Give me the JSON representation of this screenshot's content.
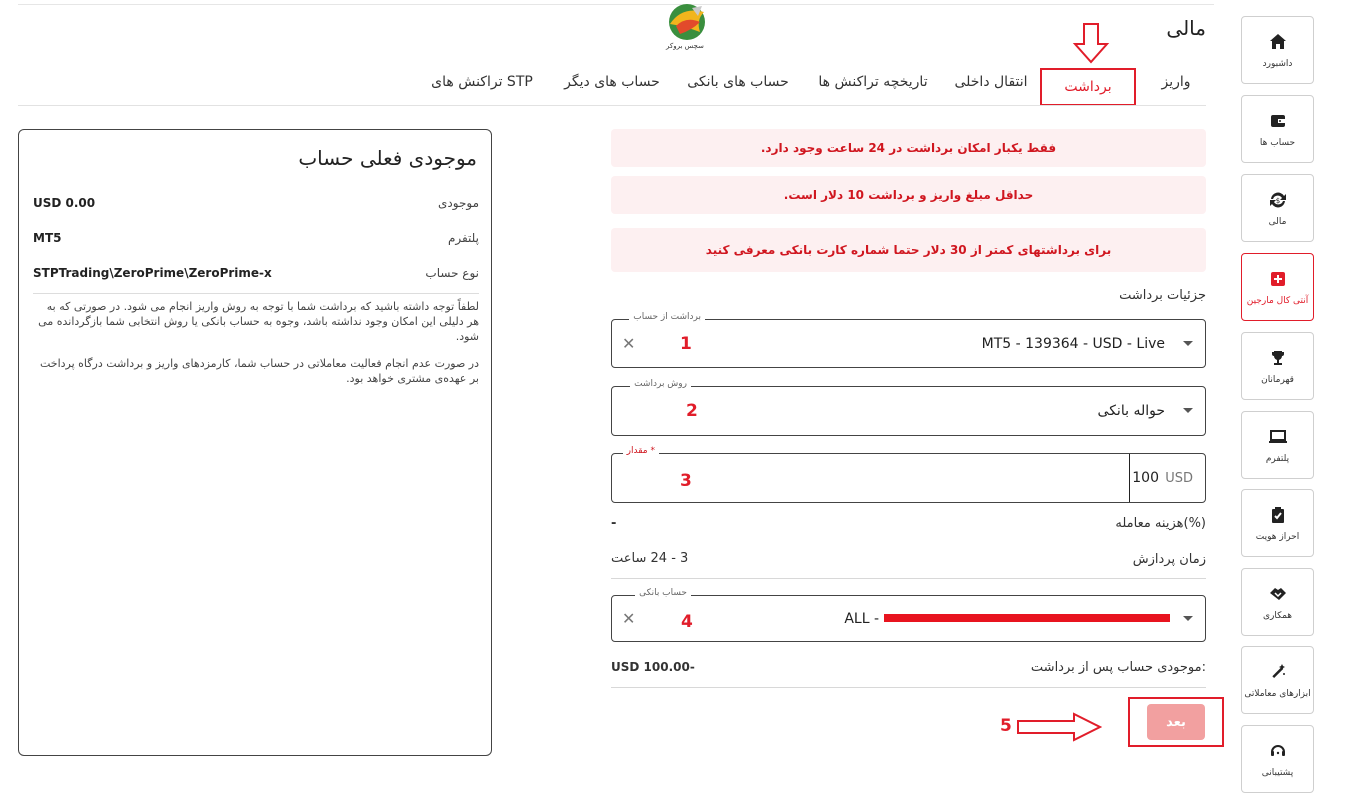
{
  "header": {
    "page_title": "مالی",
    "logo_text": "سچس بروکر"
  },
  "tabs": [
    {
      "label": "واریز"
    },
    {
      "label": "برداشت",
      "active": true
    },
    {
      "label": "انتقال داخلی"
    },
    {
      "label": "تاریخچه تراکنش ها"
    },
    {
      "label": "حساب های بانکی"
    },
    {
      "label": "حساب های دیگر"
    },
    {
      "label": "تراکنش های STP"
    }
  ],
  "sidebar": {
    "items": [
      {
        "label": "داشبورد",
        "icon": "home-icon"
      },
      {
        "label": "حساب ها",
        "icon": "wallet-icon"
      },
      {
        "label": "مالی",
        "icon": "exchange-icon"
      },
      {
        "label": "آنتی کال مارجین",
        "icon": "plus-box-icon",
        "active": true
      },
      {
        "label": "قهرمانان",
        "icon": "trophy-icon"
      },
      {
        "label": "پلتفرم",
        "icon": "laptop-icon"
      },
      {
        "label": "احراز هویت",
        "icon": "clipboard-check-icon"
      },
      {
        "label": "همکاری",
        "icon": "handshake-icon"
      },
      {
        "label": "ابزارهای معاملاتی",
        "icon": "magic-wand-icon"
      },
      {
        "label": "پشتیبانی",
        "icon": "headset-icon"
      }
    ]
  },
  "alerts": [
    "فقط یکبار امکان برداشت در 24 ساعت وجود دارد.",
    "حداقل مبلغ واریز و برداشت 10 دلار است.",
    "برای برداشتهای کمتر از 30 دلار حتما شماره کارت بانکی معرفی کنید"
  ],
  "form": {
    "section_title": "جزئیات برداشت",
    "from_account": {
      "legend": "برداشت از حساب",
      "value": "MT5 - 139364 - USD - Live"
    },
    "method": {
      "legend": "روش برداشت",
      "value": "حواله بانکی"
    },
    "amount": {
      "legend": "مقدار *",
      "value": "100",
      "currency": "USD"
    },
    "fee": {
      "label": "هزینه معامله(%)",
      "value": "-"
    },
    "processing": {
      "label": "زمان پردازش",
      "value": "3 - 24 ساعت"
    },
    "bank_account": {
      "legend": "حساب بانکی",
      "value": "ALL -"
    },
    "balance_after": {
      "label": "موجودی حساب پس از برداشت:",
      "value": "USD 100.00-"
    },
    "next_label": "بعد"
  },
  "annotations": {
    "n1": "1",
    "n2": "2",
    "n3": "3",
    "n4": "4",
    "n5": "5"
  },
  "card": {
    "title": "موجودی فعلی حساب",
    "rows": [
      {
        "key": "موجودی",
        "value": "USD 0.00"
      },
      {
        "key": "پلتفرم",
        "value": "MT5"
      },
      {
        "key": "نوع حساب",
        "value": "STPTrading\\ZeroPrime\\ZeroPrime-x"
      }
    ],
    "note1": "لطفاً توجه داشته باشید که برداشت شما با توجه به روش واریز انجام می شود. در صورتی که به هر دلیلی این امکان وجود نداشته باشد، وجوه به حساب بانکی یا روش انتخابی شما بازگردانده می شود.",
    "note2": "در صورت عدم انجام فعالیت معاملاتی در حساب شما، کارمزدهای واریز و برداشت درگاه پرداخت بر عهده‌ی مشتری خواهد بود."
  },
  "colors": {
    "accent": "#e11d2a",
    "alert_bg": "#fdf0f1",
    "button_disabled": "#f2a0a0"
  }
}
